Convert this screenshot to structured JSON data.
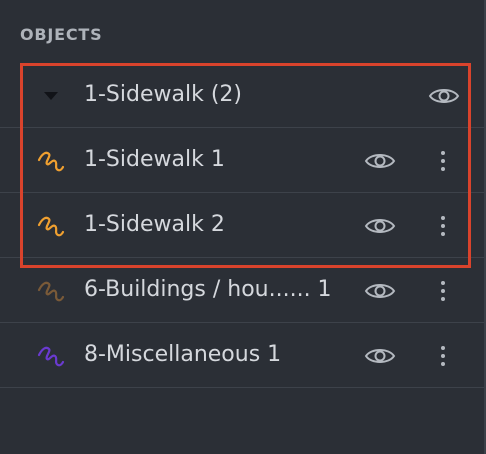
{
  "panel": {
    "header": "OBJECTS"
  },
  "rows": [
    {
      "label": "1-Sidewalk (2)",
      "icon": "caret-down-icon",
      "type": "group",
      "color": "#111318"
    },
    {
      "label": "1-Sidewalk 1",
      "icon": "squiggle-icon",
      "type": "item",
      "color": "#f0a030"
    },
    {
      "label": "1-Sidewalk 2",
      "icon": "squiggle-icon",
      "type": "item",
      "color": "#f0a030"
    },
    {
      "label": "6-Buildings / hou...... 1",
      "icon": "squiggle-icon",
      "type": "item",
      "color": "#7a5a38"
    },
    {
      "label": "8-Miscellaneous 1",
      "icon": "squiggle-icon",
      "type": "item",
      "color": "#6a3ad0"
    }
  ],
  "colors": {
    "background": "#2b2f36",
    "divider": "#3d424a",
    "highlight": "#d9432c",
    "icon_grey": "#b4b9c0"
  }
}
